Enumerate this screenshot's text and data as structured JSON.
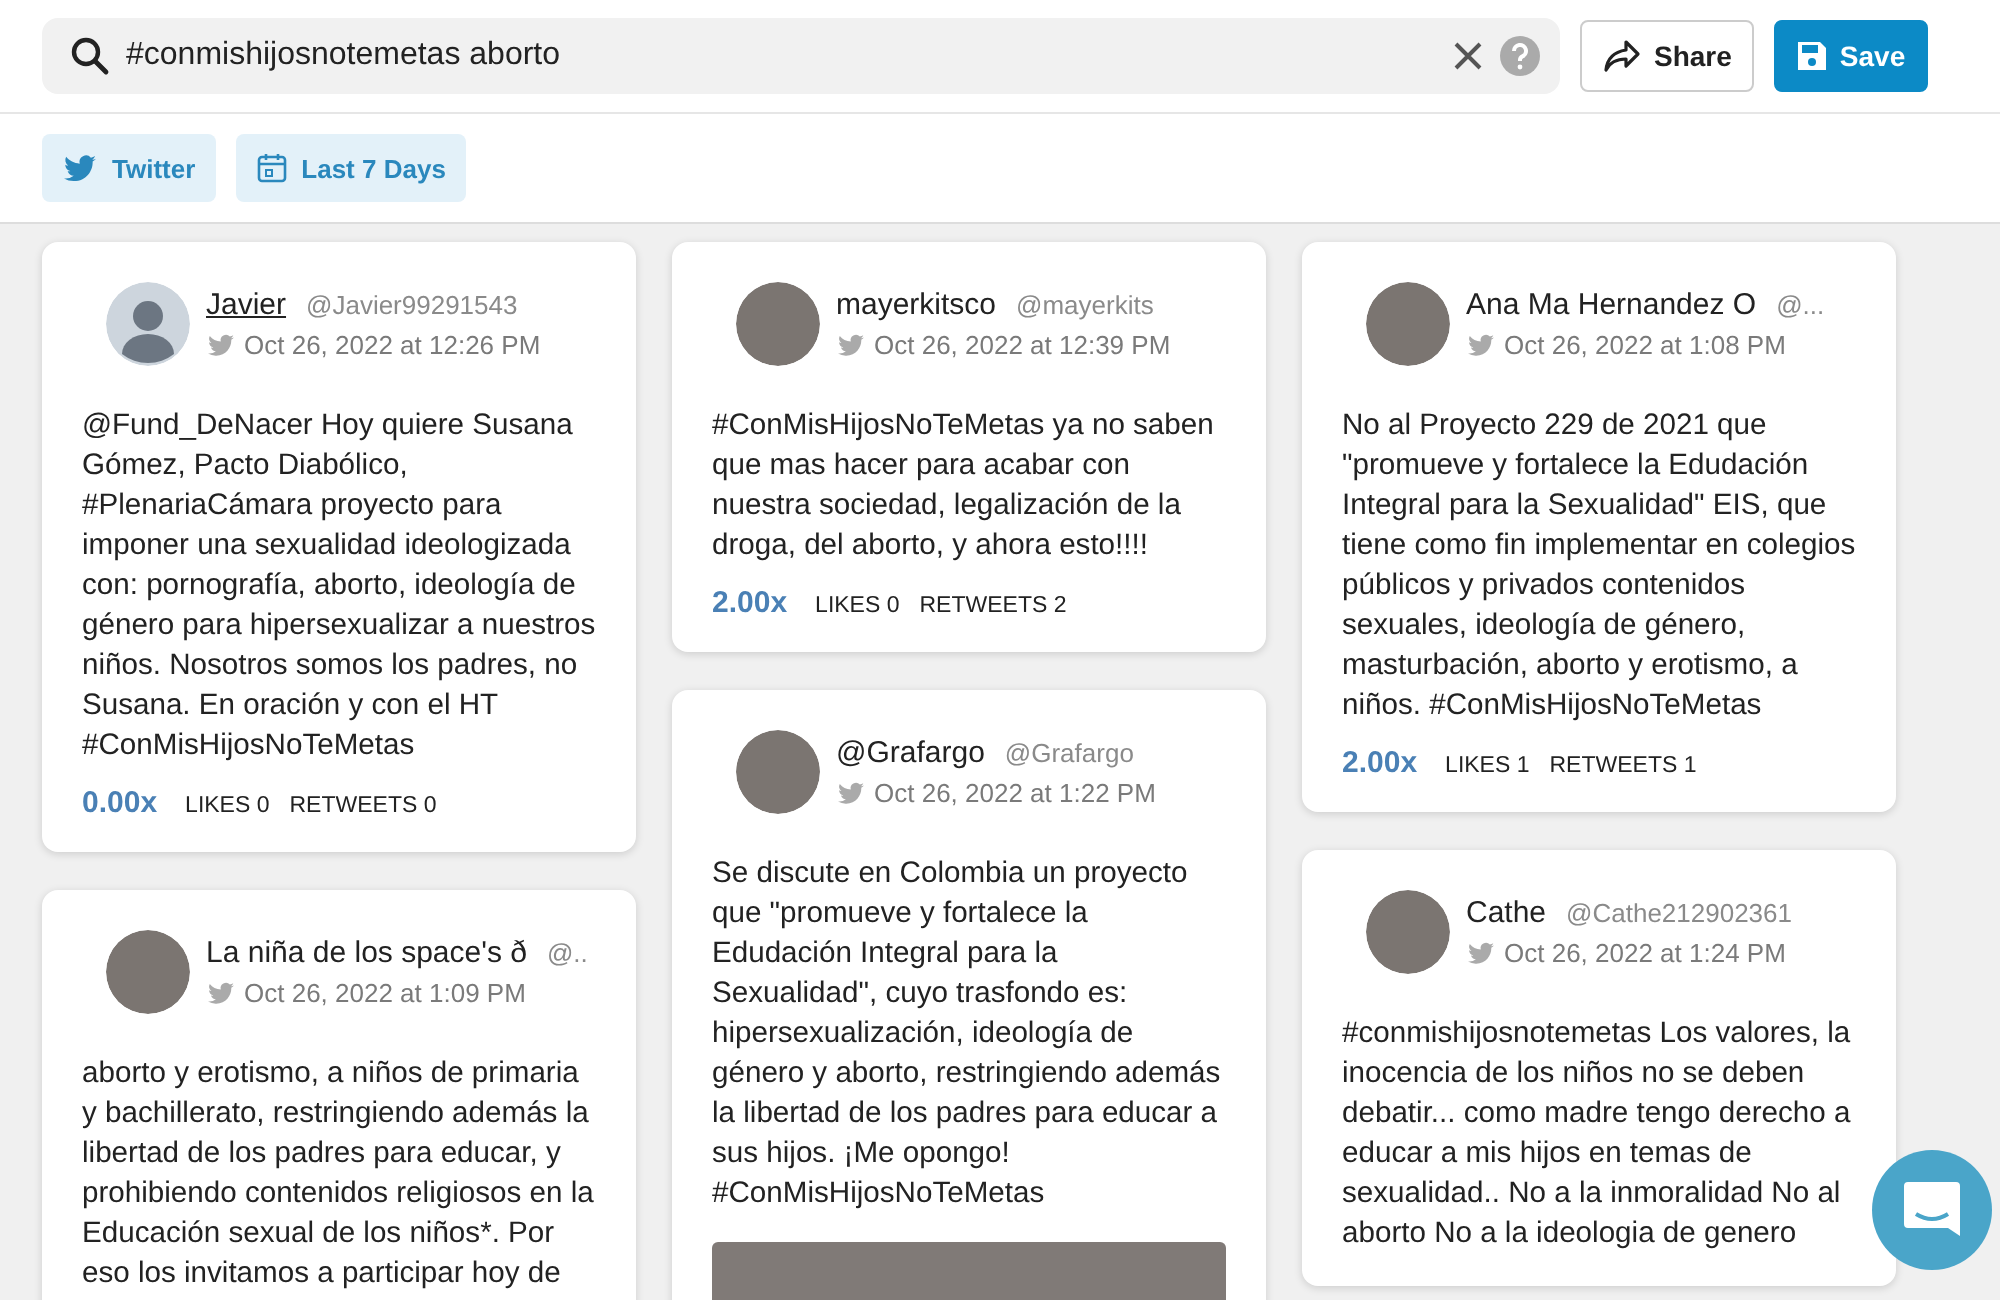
{
  "search": {
    "value": "#conmishijosnotemetas aborto"
  },
  "header_buttons": [
    {
      "kind": "share",
      "label": "Share"
    },
    {
      "kind": "save",
      "label": "Save"
    }
  ],
  "filters": [
    {
      "kind": "source",
      "label": "Twitter"
    },
    {
      "kind": "date",
      "label": "Last 7 Days"
    }
  ],
  "tweet_columns": [
    {
      "tweets": [
        {
          "kind": "default",
          "name": "Javier",
          "underlined": true,
          "handle": "@Javier99291543",
          "time": "Oct 26, 2022 at 12:26 PM",
          "text": "@Fund_DeNacer Hoy quiere Susana Gómez, Pacto Diabólico, #PlenariaCámara proyecto para imponer una sexualidad ideologizada con: pornografía, aborto, ideología de género para hipersexualizar a nuestros niños. Nosotros somos los padres, no Susana. En oración y con el HT #ConMisHijosNoTeMetas",
          "media": false,
          "multiplier": "0.00x",
          "likes": "LIKES 0",
          "retweets": "RETWEETS 0"
        },
        {
          "kind": "photo",
          "name": "La niña de los space's ð",
          "underlined": false,
          "handle": "@..",
          "time": "Oct 26, 2022 at 1:09 PM",
          "text": "aborto y erotismo, a niños de primaria y bachillerato, restringiendo además la libertad de los padres para educar, y prohibiendo contenidos religiosos en la Educación sexual de los niños*. Por eso los invitamos a participar hoy de",
          "media": false
        }
      ]
    },
    {
      "tweets": [
        {
          "kind": "photo",
          "name": "mayerkitsco",
          "underlined": false,
          "handle": "@mayerkits",
          "time": "Oct 26, 2022 at 12:39 PM",
          "text": "#ConMisHijosNoTeMetas ya no saben que mas hacer para acabar con nuestra sociedad, legalización de la droga, del aborto, y ahora esto!!!!",
          "media": false,
          "multiplier": "2.00x",
          "likes": "LIKES 0",
          "retweets": "RETWEETS 2"
        },
        {
          "kind": "photo",
          "name": "@Grafargo",
          "underlined": false,
          "handle": "@Grafargo",
          "time": "Oct 26, 2022 at 1:22 PM",
          "text": "Se discute en Colombia un proyecto que \"promueve y fortalece la Edudación Integral para la Sexualidad\", cuyo trasfondo es: hipersexualización, ideología de género y aborto, restringiendo además la libertad de los padres para educar a sus hijos. ¡Me opongo! #ConMisHijosNoTeMetas",
          "media": true
        }
      ]
    },
    {
      "tweets": [
        {
          "kind": "photo",
          "name": "Ana Ma Hernandez O",
          "underlined": false,
          "handle": "@...",
          "time": "Oct 26, 2022 at 1:08 PM",
          "text": "No al Proyecto 229 de 2021 que \"promueve y fortalece la Edudación Integral para la Sexualidad\" EIS, que tiene como fin implementar en colegios públicos y privados contenidos sexuales, ideología de género, masturbación, aborto y erotismo, a niños. #ConMisHijosNoTeMetas",
          "media": false,
          "multiplier": "2.00x",
          "likes": "LIKES 1",
          "retweets": "RETWEETS 1"
        },
        {
          "kind": "photo",
          "name": "Cathe",
          "underlined": false,
          "handle": "@Cathe212902361",
          "time": "Oct 26, 2022 at 1:24 PM",
          "text": "#conmishijosnotemetas Los valores, la inocencia de los niños no se deben debatir... como madre tengo derecho a educar a mis hijos en temas de sexualidad.. No a la inmoralidad No al aborto No a la ideologia de genero",
          "media": false
        }
      ]
    }
  ]
}
